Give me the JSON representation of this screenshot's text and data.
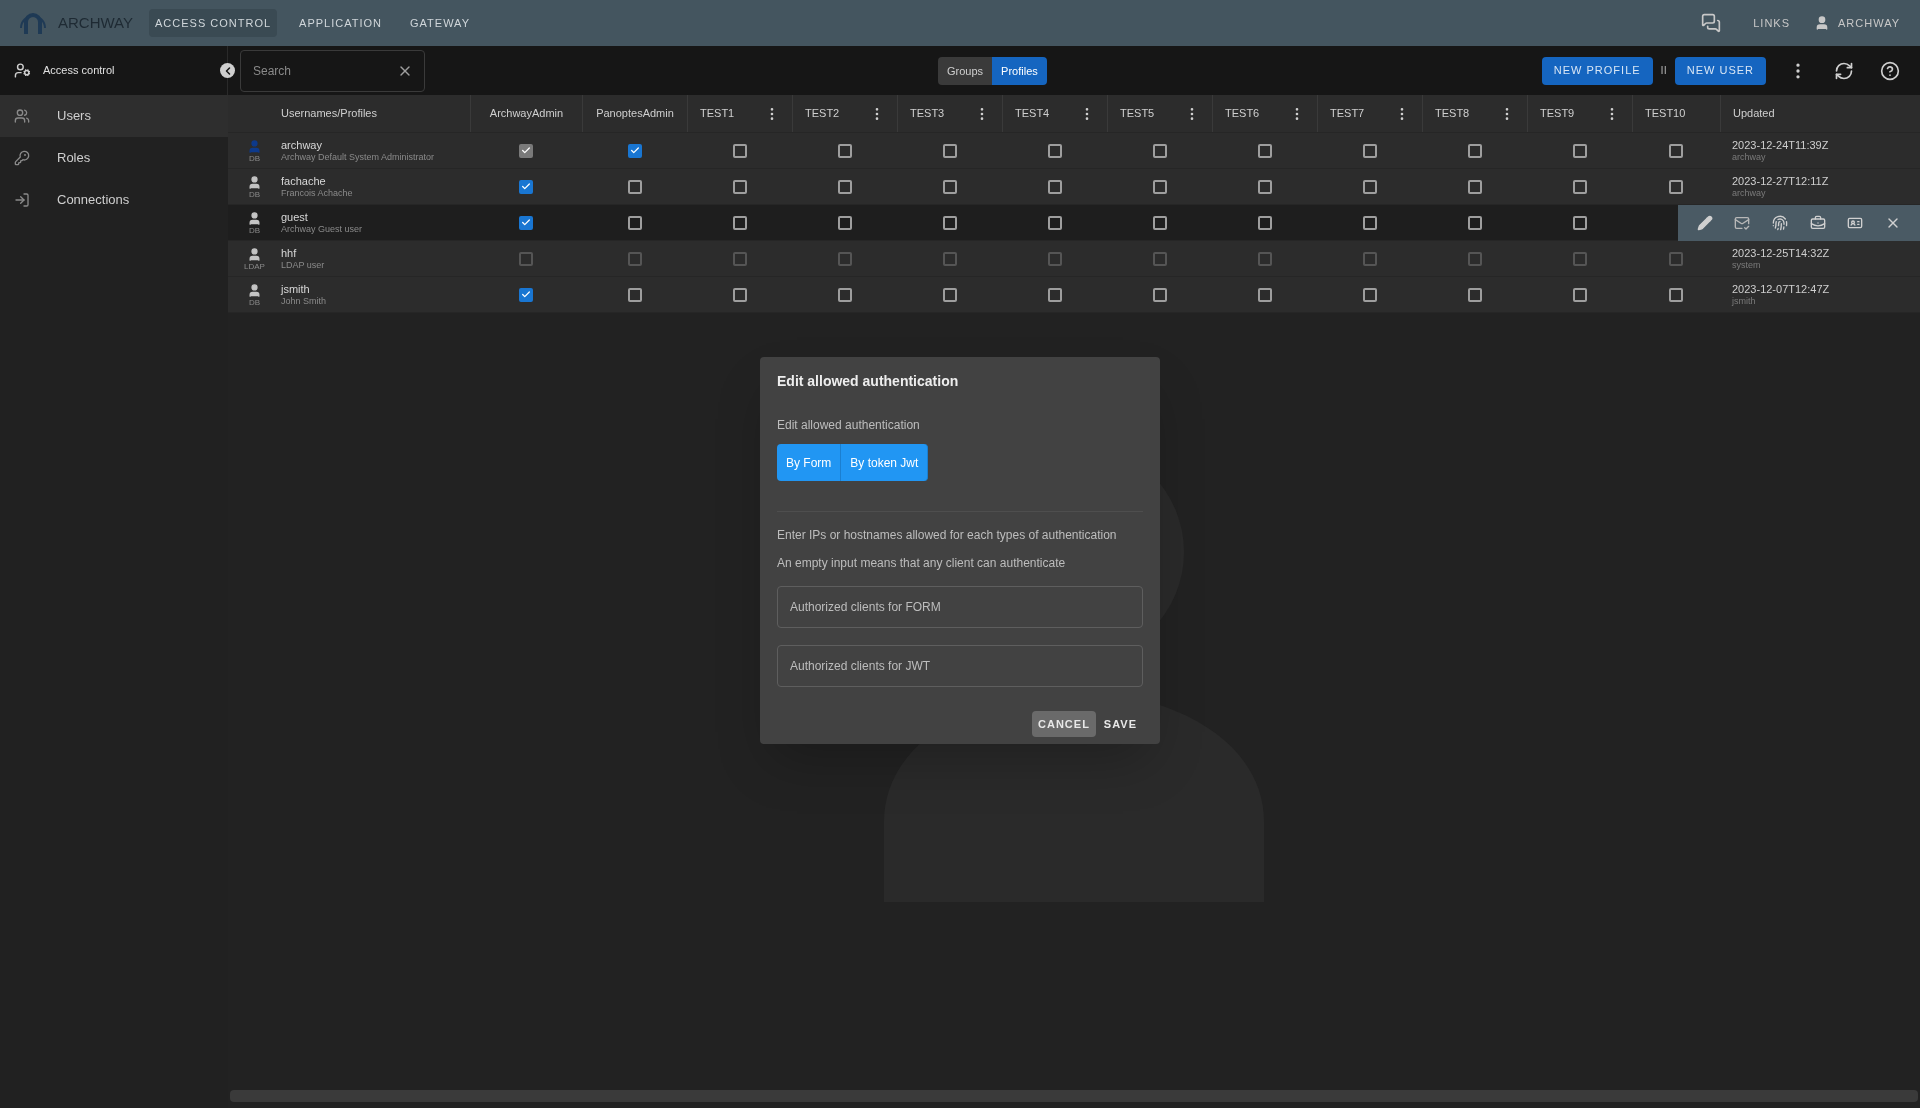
{
  "app": {
    "name": "ARCHWAY"
  },
  "nav": [
    {
      "label": "ACCESS CONTROL",
      "selected": true
    },
    {
      "label": "APPLICATION",
      "selected": false
    },
    {
      "label": "GATEWAY",
      "selected": false
    }
  ],
  "top_right": {
    "links": "LINKS",
    "user": "ARCHWAY"
  },
  "toolbar": {
    "section": "Access control",
    "search": {
      "placeholder": "Search"
    },
    "view_toggle": [
      {
        "label": "Groups",
        "selected": false
      },
      {
        "label": "Profiles",
        "selected": true
      }
    ],
    "buttons": [
      "NEW PROFILE",
      "NEW USER"
    ],
    "separator": "II"
  },
  "sidebar": {
    "items": [
      {
        "label": "Users",
        "selected": true,
        "kind": "users"
      },
      {
        "label": "Roles",
        "selected": false,
        "kind": "roles"
      },
      {
        "label": "Connections",
        "selected": false,
        "kind": "connections"
      }
    ]
  },
  "table": {
    "name_column": "Usernames/Profiles",
    "columns": [
      {
        "label": "ArchwayAdmin",
        "menu": false
      },
      {
        "label": "PanoptesAdmin",
        "menu": false
      },
      {
        "label": "TEST1",
        "menu": true
      },
      {
        "label": "TEST2",
        "menu": true
      },
      {
        "label": "TEST3",
        "menu": true
      },
      {
        "label": "TEST4",
        "menu": true
      },
      {
        "label": "TEST5",
        "menu": true
      },
      {
        "label": "TEST6",
        "menu": true
      },
      {
        "label": "TEST7",
        "menu": true
      },
      {
        "label": "TEST8",
        "menu": true
      },
      {
        "label": "TEST9",
        "menu": true
      },
      {
        "label": "TEST10",
        "menu": false
      }
    ],
    "updated_column": "Updated",
    "rows": [
      {
        "name": "archway",
        "description": "Archway Default System Administrator",
        "source": "DB",
        "current": true,
        "hovered": false,
        "updated": "2023-12-24T11:39Z",
        "updated_by": "archway",
        "cells": [
          {
            "checked": true,
            "disabled": true
          },
          {
            "checked": true,
            "disabled": false
          },
          {
            "checked": false,
            "disabled": false
          },
          {
            "checked": false,
            "disabled": false
          },
          {
            "checked": false,
            "disabled": false
          },
          {
            "checked": false,
            "disabled": false
          },
          {
            "checked": false,
            "disabled": false
          },
          {
            "checked": false,
            "disabled": false
          },
          {
            "checked": false,
            "disabled": false
          },
          {
            "checked": false,
            "disabled": false
          },
          {
            "checked": false,
            "disabled": false
          },
          {
            "checked": false,
            "disabled": false
          }
        ]
      },
      {
        "name": "fachache",
        "description": "Francois Achache",
        "source": "DB",
        "current": false,
        "hovered": false,
        "updated": "2023-12-27T12:11Z",
        "updated_by": "archway",
        "cells": [
          {
            "checked": true,
            "disabled": false
          },
          {
            "checked": false,
            "disabled": false
          },
          {
            "checked": false,
            "disabled": false
          },
          {
            "checked": false,
            "disabled": false
          },
          {
            "checked": false,
            "disabled": false
          },
          {
            "checked": false,
            "disabled": false
          },
          {
            "checked": false,
            "disabled": false
          },
          {
            "checked": false,
            "disabled": false
          },
          {
            "checked": false,
            "disabled": false
          },
          {
            "checked": false,
            "disabled": false
          },
          {
            "checked": false,
            "disabled": false
          },
          {
            "checked": false,
            "disabled": false
          }
        ]
      },
      {
        "name": "guest",
        "description": "Archway Guest user",
        "source": "DB",
        "current": false,
        "hovered": true,
        "cells": [
          {
            "checked": true,
            "disabled": false
          },
          {
            "checked": false,
            "disabled": false
          },
          {
            "checked": false,
            "disabled": false
          },
          {
            "checked": false,
            "disabled": false
          },
          {
            "checked": false,
            "disabled": false
          },
          {
            "checked": false,
            "disabled": false
          },
          {
            "checked": false,
            "disabled": false
          },
          {
            "checked": false,
            "disabled": false
          },
          {
            "checked": false,
            "disabled": false
          },
          {
            "checked": false,
            "disabled": false
          },
          {
            "checked": false,
            "disabled": false
          }
        ]
      },
      {
        "name": "hhf",
        "description": "LDAP user",
        "source": "LDAP",
        "current": false,
        "hovered": false,
        "updated": "2023-12-25T14:32Z",
        "updated_by": "system",
        "cells": [
          {
            "checked": false,
            "disabled": true
          },
          {
            "checked": false,
            "disabled": true
          },
          {
            "checked": false,
            "disabled": true
          },
          {
            "checked": false,
            "disabled": true
          },
          {
            "checked": false,
            "disabled": true
          },
          {
            "checked": false,
            "disabled": true
          },
          {
            "checked": false,
            "disabled": true
          },
          {
            "checked": false,
            "disabled": true
          },
          {
            "checked": false,
            "disabled": true
          },
          {
            "checked": false,
            "disabled": true
          },
          {
            "checked": false,
            "disabled": true
          },
          {
            "checked": false,
            "disabled": true
          }
        ]
      },
      {
        "name": "jsmith",
        "description": "John Smith",
        "source": "DB",
        "current": false,
        "hovered": false,
        "updated": "2023-12-07T12:47Z",
        "updated_by": "jsmith",
        "cells": [
          {
            "checked": true,
            "disabled": false
          },
          {
            "checked": false,
            "disabled": false
          },
          {
            "checked": false,
            "disabled": false
          },
          {
            "checked": false,
            "disabled": false
          },
          {
            "checked": false,
            "disabled": false
          },
          {
            "checked": false,
            "disabled": false
          },
          {
            "checked": false,
            "disabled": false
          },
          {
            "checked": false,
            "disabled": false
          },
          {
            "checked": false,
            "disabled": false
          },
          {
            "checked": false,
            "disabled": false
          },
          {
            "checked": false,
            "disabled": false
          },
          {
            "checked": false,
            "disabled": false
          }
        ]
      }
    ]
  },
  "dialog": {
    "title": "Edit allowed authentication",
    "subtitle": "Edit allowed authentication",
    "options": [
      {
        "label": "By Form",
        "selected": true
      },
      {
        "label": "By token Jwt",
        "selected": true
      }
    ],
    "help": [
      "Enter IPs or hostnames allowed for each types of authentication",
      "An empty input means that any client can authenticate"
    ],
    "fields": [
      {
        "placeholder": "Authorized clients for FORM"
      },
      {
        "placeholder": "Authorized clients for JWT"
      }
    ],
    "cancel": "CANCEL",
    "save": "SAVE"
  }
}
